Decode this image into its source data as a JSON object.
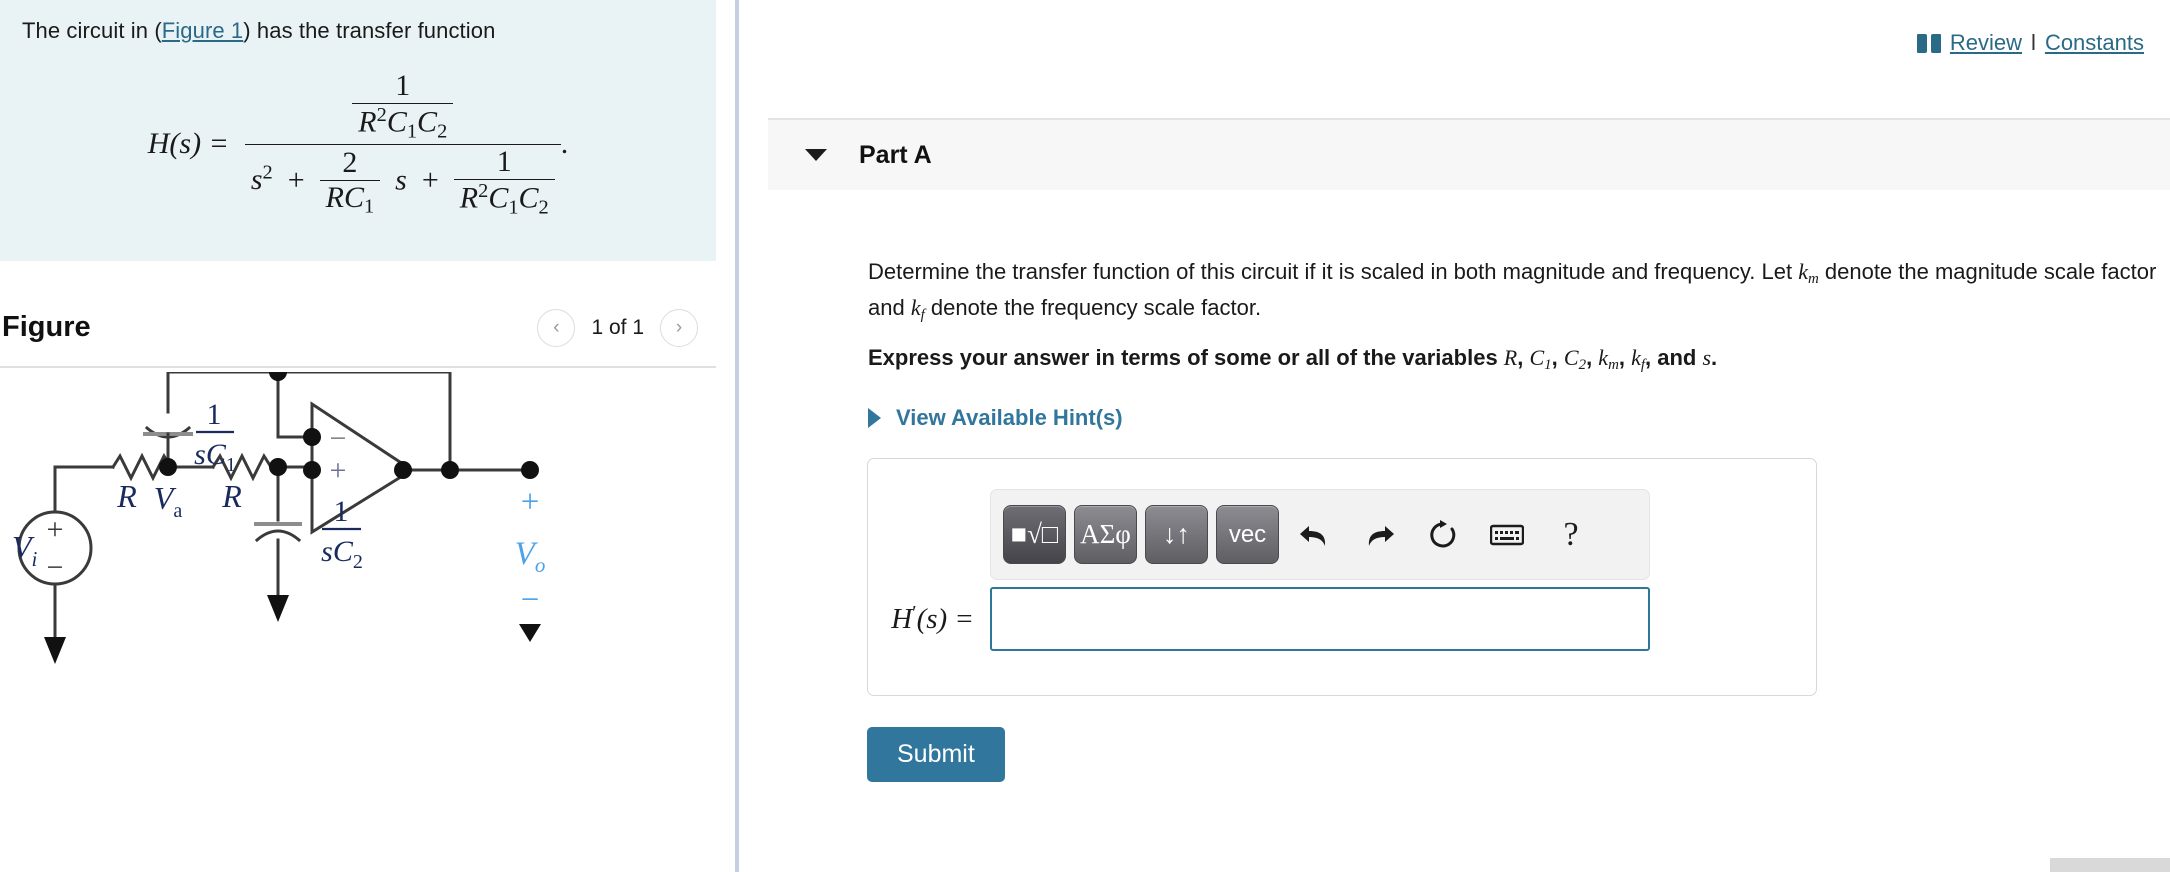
{
  "left": {
    "statement": {
      "prefix": "The circuit in (",
      "link": "Figure 1",
      "suffix": ") has the transfer function"
    },
    "formula": {
      "lhs": "H(s) =",
      "numerator_top": "1",
      "numerator_bottom": "R²C₁C₂",
      "denominator": "s² + 2/(RC₁) s + 1/(R²C₁C₂)",
      "trailing": "."
    },
    "figure": {
      "title": "Figure",
      "prev_label": "‹",
      "next_label": "›",
      "counter": "1 of 1"
    },
    "circuit": {
      "labels": {
        "source": "V",
        "source_sub": "i",
        "node_a": "V",
        "node_a_sub": "a",
        "r1": "R",
        "r2": "R",
        "c1_num": "1",
        "c1_den": "sC₁",
        "c2_num": "1",
        "c2_den": "sC₂",
        "out": "V",
        "out_sub": "o",
        "plus": "+",
        "minus": "−",
        "opamp_minus": "−",
        "opamp_plus": "+"
      },
      "colors": {
        "wire": "#3a3a3a",
        "label_dark": "#1a2a5e",
        "label_blue": "#4ea3e8",
        "accent_orange": "#c8862a"
      }
    }
  },
  "right": {
    "review": {
      "book_icon": "book-icon",
      "review_label": "Review",
      "separator": "l",
      "constants_label": "Constants"
    },
    "part": {
      "caret_icon": "caret-down-icon",
      "title": "Part A"
    },
    "question": {
      "body_1": "Determine the transfer function of this circuit if it is scaled in both magnitude and frequency. Let ",
      "body_km": "k",
      "body_km_sub": "m",
      "body_2": " denote the magnitude scale factor and ",
      "body_kf": "k",
      "body_kf_sub": "f",
      "body_3": " denote the frequency scale factor.",
      "bold_prefix": "Express your answer in terms of some or all of the variables ",
      "bold_vars": "R, C₁, C₂, kₘ, kғ, and s.",
      "hints_label": "View Available Hint(s)",
      "hints_caret": "caret-right-icon"
    },
    "toolbar": {
      "buttons": [
        {
          "name": "template-button",
          "label": "■√□",
          "style": "dark"
        },
        {
          "name": "greek-symbols-button",
          "label": "ΑΣφ",
          "style": "light"
        },
        {
          "name": "arrows-button",
          "label": "↓↑",
          "style": "light"
        },
        {
          "name": "vector-button",
          "label": "vec",
          "style": "light"
        }
      ],
      "icons": [
        {
          "name": "undo-icon",
          "glyph": "⬅"
        },
        {
          "name": "redo-icon",
          "glyph": "➡"
        },
        {
          "name": "reset-icon",
          "glyph": "↻"
        },
        {
          "name": "keyboard-icon",
          "glyph": "⌨"
        },
        {
          "name": "help-icon",
          "glyph": "?"
        }
      ]
    },
    "answer": {
      "label_h": "H",
      "label_prime": "′",
      "label_rest": "(s) =",
      "value": "",
      "placeholder": ""
    },
    "submit_label": "Submit"
  },
  "colors": {
    "statement_bg": "#e9f3f5",
    "accent_teal": "#31769c",
    "link_teal": "#2b6a86",
    "panel_header_bg": "#f7f7f7",
    "splitter": "#c3cfe2",
    "input_border": "#2f7699",
    "circuit_blue": "#4ea3e8"
  }
}
